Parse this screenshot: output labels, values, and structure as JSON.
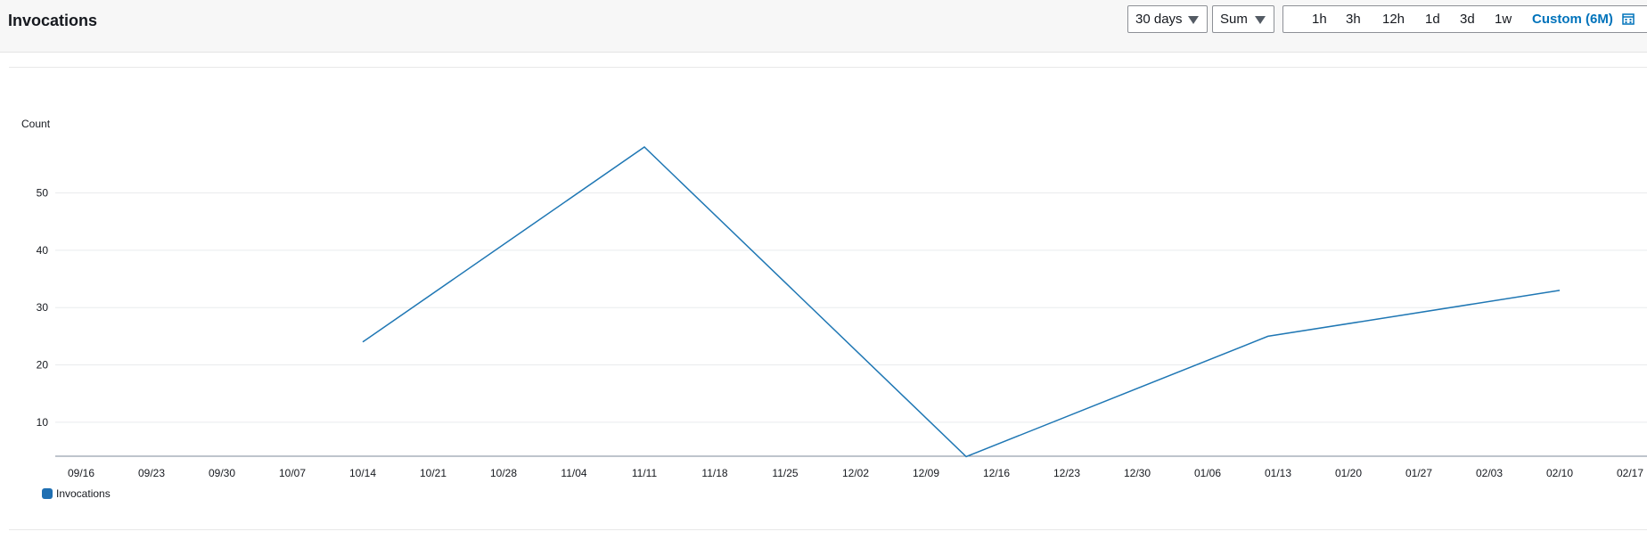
{
  "header": {
    "title": "Invocations",
    "period_select": "30 days",
    "stat_select": "Sum",
    "ranges": [
      "1h",
      "3h",
      "12h",
      "1d",
      "3d",
      "1w"
    ],
    "active_range": "Custom (6M)"
  },
  "colors": {
    "series": "#1f77b4",
    "active": "#0073bb"
  },
  "chart_data": {
    "type": "line",
    "ylabel": "Count",
    "yticks": [
      10,
      20,
      30,
      40,
      50
    ],
    "xticks": [
      "09/16",
      "09/23",
      "09/30",
      "10/07",
      "10/14",
      "10/21",
      "10/28",
      "11/04",
      "11/11",
      "11/18",
      "11/25",
      "12/02",
      "12/09",
      "12/16",
      "12/23",
      "12/30",
      "01/06",
      "01/13",
      "01/20",
      "01/27",
      "02/03",
      "02/10",
      "02/17"
    ],
    "series": [
      {
        "name": "Invocations",
        "x": [
          "10/14",
          "11/11",
          "12/13",
          "01/12",
          "02/10"
        ],
        "values": [
          24,
          58,
          4,
          25,
          33
        ]
      }
    ]
  },
  "legend": {
    "label": "Invocations"
  }
}
